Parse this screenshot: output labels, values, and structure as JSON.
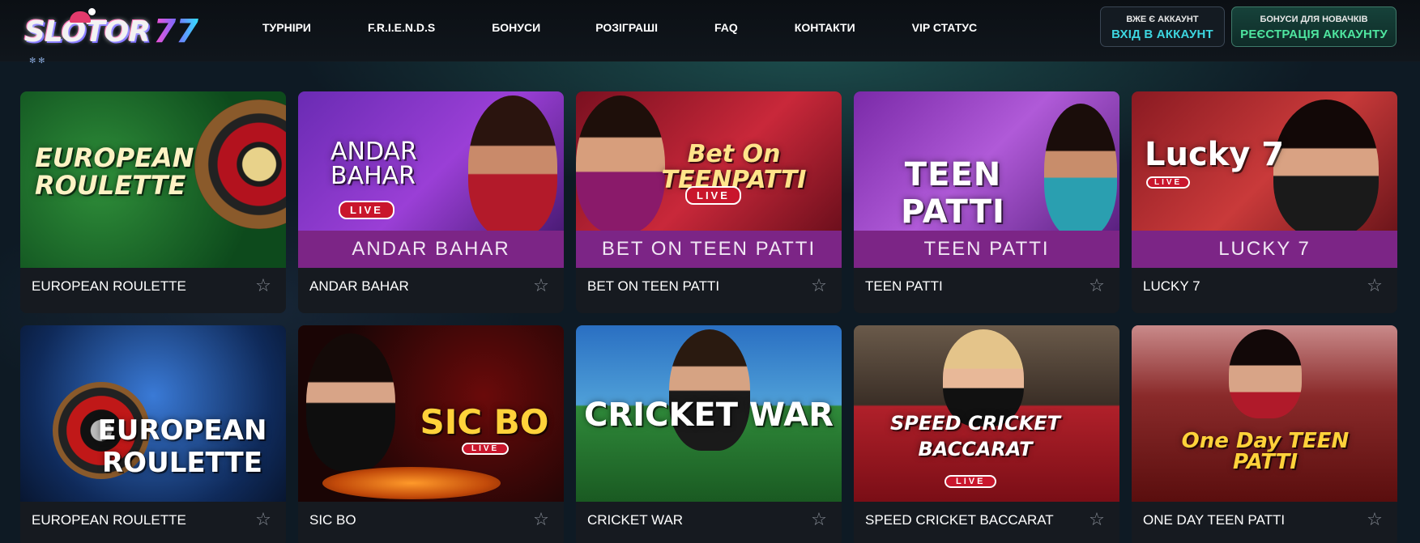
{
  "header": {
    "logo_text": "SLOTOR",
    "logo_suffix": "77",
    "nav": [
      {
        "label": "ТУРНІРИ"
      },
      {
        "label": "F.R.I.E.N.D.S"
      },
      {
        "label": "БОНУСИ"
      },
      {
        "label": "РОЗІГРАШІ"
      },
      {
        "label": "FAQ"
      },
      {
        "label": "КОНТАКТИ"
      },
      {
        "label": "VIP СТАТУС"
      }
    ],
    "login": {
      "small": "ВЖЕ Є АККАУНТ",
      "big": "ВХІД В АККАУНТ"
    },
    "register": {
      "small": "БОНУСИ ДЛЯ НОВАЧКІВ",
      "big": "РЕЄСТРАЦІЯ АККАУНТУ"
    }
  },
  "games": [
    {
      "title": "EUROPEAN ROULETTE",
      "art_text": "EUROPEAN ROULETTE",
      "banner": "",
      "live": "",
      "theme": "green"
    },
    {
      "title": "ANDAR BAHAR",
      "art_text": "ANDAR BAHAR",
      "banner": "ANDAR BAHAR",
      "live": "LIVE",
      "theme": "purple"
    },
    {
      "title": "BET ON TEEN PATTI",
      "art_text": "Bet On TEENPATTI",
      "banner": "BET ON TEEN PATTI",
      "live": "LIVE",
      "theme": "red"
    },
    {
      "title": "TEEN PATTI",
      "art_text": "TEEN PATTI",
      "banner": "TEEN PATTI",
      "live": "",
      "theme": "violet"
    },
    {
      "title": "LUCKY 7",
      "art_text": "Lucky 7",
      "banner": "LUCKY 7",
      "live": "LIVE",
      "theme": "crimson"
    },
    {
      "title": "EUROPEAN ROULETTE",
      "art_text": "EUROPEAN ROULETTE",
      "banner": "",
      "live": "",
      "theme": "blue"
    },
    {
      "title": "SIC BO",
      "art_text": "SIC BO",
      "banner": "",
      "live": "LIVE",
      "theme": "dark"
    },
    {
      "title": "CRICKET WAR",
      "art_text": "CRICKET WAR",
      "banner": "",
      "live": "",
      "theme": "stadium"
    },
    {
      "title": "SPEED CRICKET BACCARAT",
      "art_text": "SPEED CRICKET BACCARAT",
      "banner": "",
      "live": "LIVE",
      "theme": "table"
    },
    {
      "title": "ONE DAY TEEN PATTI",
      "art_text": "One Day TEEN PATTI",
      "banner": "",
      "live": "",
      "theme": "rose"
    }
  ],
  "favorite_icon": "star-outline-icon"
}
